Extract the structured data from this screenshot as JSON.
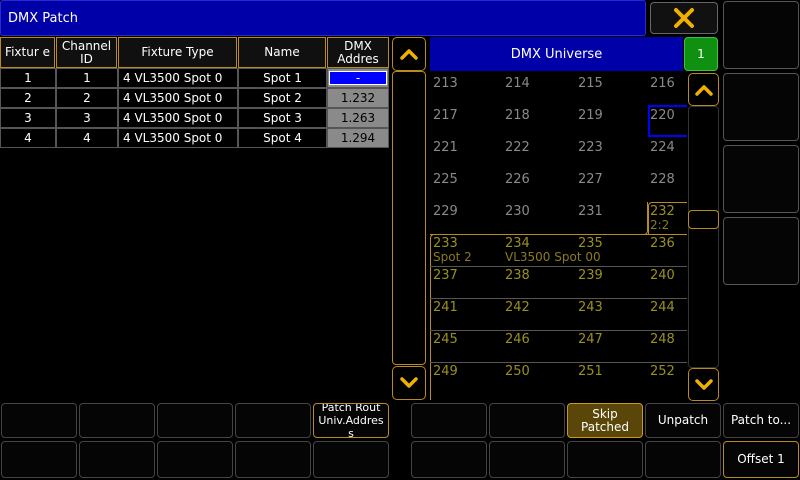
{
  "window": {
    "title": "DMX Patch"
  },
  "table": {
    "headers": {
      "fixture": "Fixtur e",
      "channel": "Channel ID",
      "type": "Fixture Type",
      "name": "Name",
      "address": "DMX Addres"
    },
    "rows": [
      {
        "fixture": "1",
        "channel": "1",
        "type": "4 VL3500 Spot 0",
        "name": "Spot 1",
        "address": "-"
      },
      {
        "fixture": "2",
        "channel": "2",
        "type": "4 VL3500 Spot 0",
        "name": "Spot 2",
        "address": "1.232"
      },
      {
        "fixture": "3",
        "channel": "3",
        "type": "4 VL3500 Spot 0",
        "name": "Spot 3",
        "address": "1.263"
      },
      {
        "fixture": "4",
        "channel": "4",
        "type": "4 VL3500 Spot 0",
        "name": "Spot 4",
        "address": "1.294"
      }
    ]
  },
  "universe": {
    "title": "DMX Universe",
    "number": "1",
    "cells": [
      "213",
      "214",
      "215",
      "216",
      "217",
      "218",
      "219",
      "220",
      "221",
      "222",
      "223",
      "224",
      "225",
      "226",
      "227",
      "228",
      "229",
      "230",
      "231",
      "232",
      "233",
      "234",
      "235",
      "236",
      "237",
      "238",
      "239",
      "240",
      "241",
      "242",
      "243",
      "244",
      "245",
      "246",
      "247",
      "248",
      "249",
      "250",
      "251",
      "252"
    ],
    "patch_block": {
      "start_sub": "2:2",
      "fixture_name": "Spot 2",
      "fixture_type": "VL3500 Spot 00"
    }
  },
  "bottom": {
    "patch_route": "Patch Rout Univ.Addres s",
    "skip_patched": "Skip Patched",
    "unpatch": "Unpatch",
    "patch_to": "Patch to...",
    "offset": "Offset 1"
  },
  "icons": {
    "close": "close-x-icon",
    "up": "chevron-up-icon",
    "down": "chevron-down-icon"
  },
  "colors": {
    "accent": "#b88a20",
    "title_bar": "#0000a8",
    "universe_indicator": "#109010",
    "selection": "#0000ff"
  }
}
